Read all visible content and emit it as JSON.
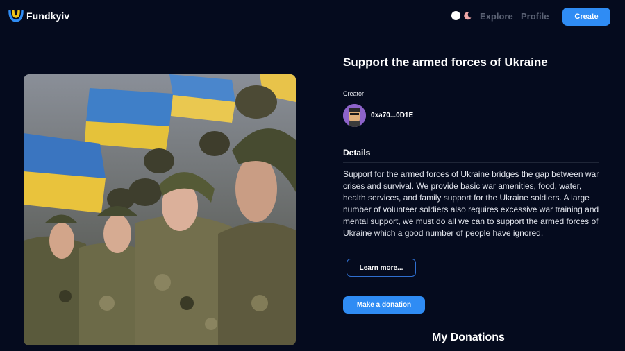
{
  "brand": {
    "name": "Fundkyiv"
  },
  "nav": {
    "explore": "Explore",
    "profile": "Profile",
    "create": "Create",
    "theme_light_icon": "sun-icon",
    "theme_dark_icon": "moon-icon"
  },
  "campaign": {
    "title": "Support the armed forces of Ukraine",
    "image_alt": "Ukrainian soldiers in camouflage standing in formation with Ukrainian flags",
    "creator_label": "Creator",
    "creator_address": "0xa70...0D1E",
    "details_label": "Details",
    "details_text": "Support for the armed forces of Ukraine bridges the gap between war crises and survival. We provide basic war amenities, food, water, health services, and family support for the Ukraine soldiers. A large number of volunteer soldiers also requires excessive war training and mental support, we must do all we can to support the armed forces of Ukraine which a good number of people have ignored.",
    "learn_more": "Learn more...",
    "donate": "Make a donation"
  },
  "donations": {
    "heading": "My Donations"
  },
  "colors": {
    "background": "#050b1e",
    "accent": "#2f8cf4",
    "muted": "#5b6274"
  }
}
